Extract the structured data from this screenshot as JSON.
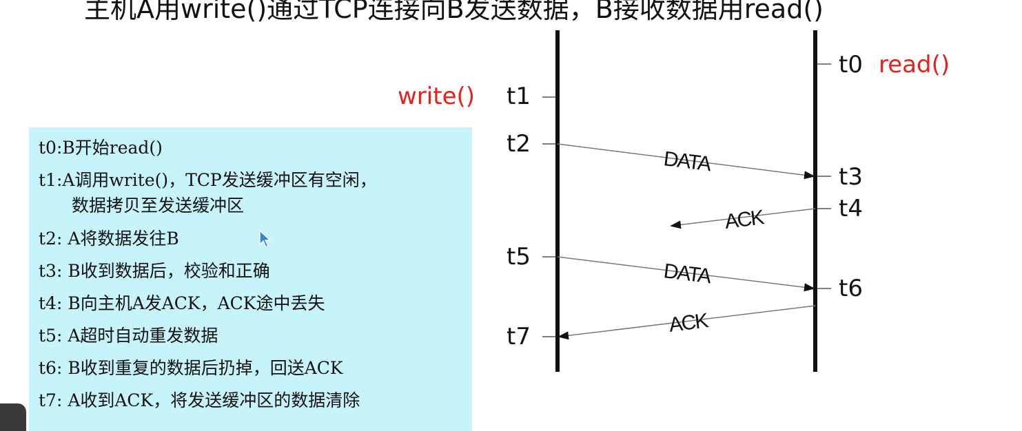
{
  "title": "主机A用write()通过TCP连接向B发送数据，B接收数据用read()",
  "notes": [
    "t0:B开始read()",
    "t1:A调用write()，TCP发送缓冲区有空闲，",
    "数据拷贝至发送缓冲区",
    "t2: A将数据发往B",
    "t3: B收到数据后，校验和正确",
    "t4: B向主机A发ACK，ACK途中丢失",
    "t5: A超时自动重发数据",
    "t6: B收到重复的数据后扔掉，回送ACK",
    "t7: A收到ACK，将发送缓冲区的数据清除"
  ],
  "diagram": {
    "left_call": "write()",
    "right_call": "read()",
    "times": {
      "t0": "t0",
      "t1": "t1",
      "t2": "t2",
      "t3": "t3",
      "t4": "t4",
      "t5": "t5",
      "t6": "t6",
      "t7": "t7"
    },
    "messages": {
      "data1": "DATA",
      "ack1": "ACK",
      "data2": "DATA",
      "ack2": "ACK"
    },
    "colors": {
      "call_text": "#e0241b",
      "notes_bg": "#c7f3fb"
    }
  }
}
